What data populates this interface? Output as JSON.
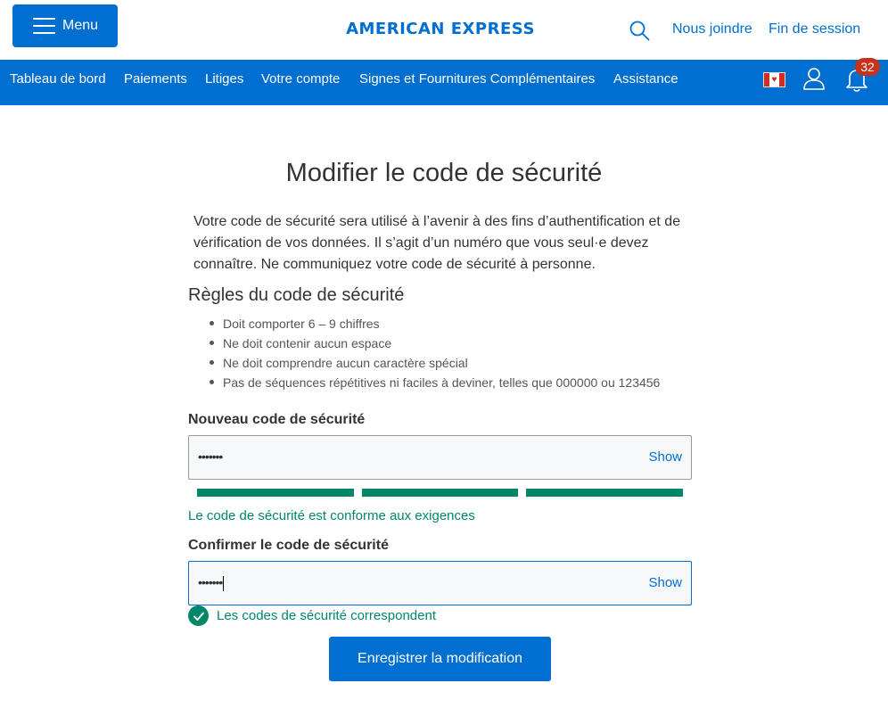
{
  "header": {
    "menu_label": "Menu",
    "logo_text": "AMERICAN EXPRESS",
    "contact_label": "Nous joindre",
    "logout_label": "Fin de session"
  },
  "nav": {
    "items": [
      "Tableau de bord",
      "Paiements",
      "Litiges",
      "Votre compte",
      "Signes et Fournitures Complémentaires",
      "Assistance"
    ],
    "notification_count": "32",
    "flag": "canada-flag-icon"
  },
  "main": {
    "title": "Modifier le code de sécurité",
    "intro": "Votre code de sécurité sera utilisé à l’avenir à des fins d’authentification et de vérification de vos données. Il s’agit d’un numéro que vous seul·e devez connaître. Ne communiquez votre code de sécurité à personne.",
    "rules_title": "Règles du code de sécurité",
    "rules": [
      "Doit comporter 6 – 9 chiffres",
      "Ne doit contenir aucun espace",
      "Ne doit comprendre aucun caractère spécial",
      "Pas de séquences répétitives ni faciles à deviner, telles que 000000 ou 123456"
    ],
    "new_code": {
      "label": "Nouveau code de sécurité",
      "value": "•••••••",
      "show_label": "Show",
      "strength_level": "3/3",
      "message": "Le code de sécurité est conforme aux exigences"
    },
    "confirm_code": {
      "label": "Confirmer le code de sécurité",
      "value": "•••••••",
      "show_label": "Show",
      "message": "Les codes de sécurité correspondent"
    },
    "save_label": "Enregistrer la modification"
  },
  "colors": {
    "brand_blue": "#006fcf",
    "success_green": "#008767",
    "badge_red": "#c8321c"
  }
}
